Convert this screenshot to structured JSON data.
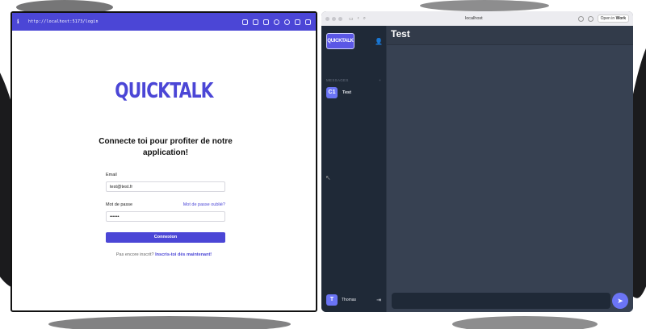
{
  "left_window": {
    "url": "http://localhost:5173/login",
    "logo_text": "QUICKTALK",
    "heading": "Connecte toi pour profiter de notre application!",
    "email_label": "Email",
    "email_value": "test@test.fr",
    "password_label": "Mot de passe",
    "forgot_link": "Mot de passe oublié?",
    "password_value": "••••••",
    "login_button": "Connexion",
    "signup_prompt": "Pas encore inscrit?",
    "signup_link": "Inscris-toi dès maintenant!"
  },
  "right_window": {
    "browser_title": "localhost",
    "open_in_prefix": "Open in",
    "open_in_app": "Work",
    "sidebar": {
      "logo_text": "QUICKTALK",
      "section_label": "MESSAGES",
      "section_action": "+",
      "conversations": [
        {
          "avatar": "C1",
          "name": "Test"
        }
      ],
      "user_avatar": "T",
      "user_name": "Thomas"
    },
    "chat_title": "Test"
  },
  "colors": {
    "brand": "#4b46d6",
    "accent": "#6b74f5",
    "sidebar_bg": "#1f2937",
    "main_bg": "#374152"
  }
}
